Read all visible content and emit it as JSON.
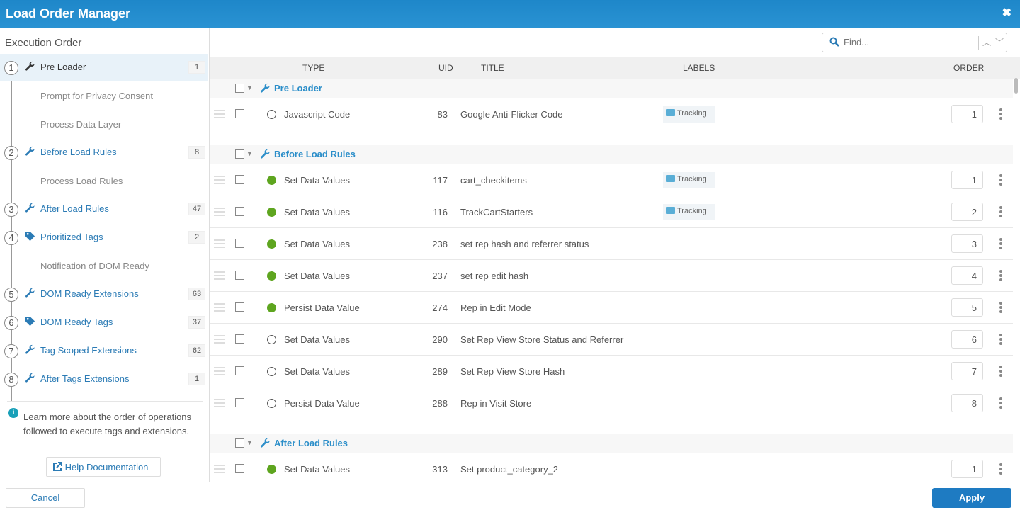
{
  "window": {
    "title": "Load Order Manager",
    "close_icon": "close-icon"
  },
  "sidebar": {
    "heading": "Execution Order",
    "steps": [
      {
        "num": "1",
        "label": "Pre Loader",
        "count": "1",
        "icon": "wrench-icon",
        "active": true
      },
      {
        "num": "2",
        "label": "Before Load Rules",
        "count": "8",
        "icon": "wrench-icon"
      },
      {
        "num": "3",
        "label": "After Load Rules",
        "count": "47",
        "icon": "wrench-icon"
      },
      {
        "num": "4",
        "label": "Prioritized Tags",
        "count": "2",
        "icon": "tag-icon"
      },
      {
        "num": "5",
        "label": "DOM Ready Extensions",
        "count": "63",
        "icon": "wrench-icon"
      },
      {
        "num": "6",
        "label": "DOM Ready Tags",
        "count": "37",
        "icon": "tag-icon"
      },
      {
        "num": "7",
        "label": "Tag Scoped Extensions",
        "count": "62",
        "icon": "wrench-icon"
      },
      {
        "num": "8",
        "label": "After Tags Extensions",
        "count": "1",
        "icon": "wrench-icon"
      }
    ],
    "substeps": [
      "Prompt for Privacy Consent",
      "Process Data Layer",
      "Process Load Rules",
      "Notification of DOM Ready"
    ],
    "info_text": "Learn more about the order of operations followed to execute tags and extensions.",
    "help_label": "Help Documentation"
  },
  "search": {
    "placeholder": "Find..."
  },
  "table": {
    "headers": {
      "type": "TYPE",
      "uid": "UID",
      "title": "TITLE",
      "labels": "LABELS",
      "order": "ORDER"
    },
    "groups": [
      {
        "name": "Pre Loader",
        "rows": [
          {
            "status": "inactive",
            "type": "Javascript Code",
            "uid": "83",
            "title": "Google Anti-Flicker Code",
            "label": "Tracking",
            "order": "1"
          }
        ]
      },
      {
        "name": "Before Load Rules",
        "rows": [
          {
            "status": "active",
            "type": "Set Data Values",
            "uid": "117",
            "title": "cart_checkitems",
            "label": "Tracking",
            "order": "1"
          },
          {
            "status": "active",
            "type": "Set Data Values",
            "uid": "116",
            "title": "TrackCartStarters",
            "label": "Tracking",
            "order": "2"
          },
          {
            "status": "active",
            "type": "Set Data Values",
            "uid": "238",
            "title": "set rep hash and referrer status",
            "label": "",
            "order": "3"
          },
          {
            "status": "active",
            "type": "Set Data Values",
            "uid": "237",
            "title": "set rep edit hash",
            "label": "",
            "order": "4"
          },
          {
            "status": "active",
            "type": "Persist Data Value",
            "uid": "274",
            "title": "Rep in Edit Mode",
            "label": "",
            "order": "5"
          },
          {
            "status": "inactive",
            "type": "Set Data Values",
            "uid": "290",
            "title": "Set Rep View Store Status and Referrer",
            "label": "",
            "order": "6"
          },
          {
            "status": "inactive",
            "type": "Set Data Values",
            "uid": "289",
            "title": "Set Rep View Store Hash",
            "label": "",
            "order": "7"
          },
          {
            "status": "inactive",
            "type": "Persist Data Value",
            "uid": "288",
            "title": "Rep in Visit Store",
            "label": "",
            "order": "8"
          }
        ]
      },
      {
        "name": "After Load Rules",
        "rows": [
          {
            "status": "active",
            "type": "Set Data Values",
            "uid": "313",
            "title": "Set product_category_2",
            "label": "",
            "order": "1"
          }
        ]
      }
    ]
  },
  "footer": {
    "cancel": "Cancel",
    "apply": "Apply"
  }
}
